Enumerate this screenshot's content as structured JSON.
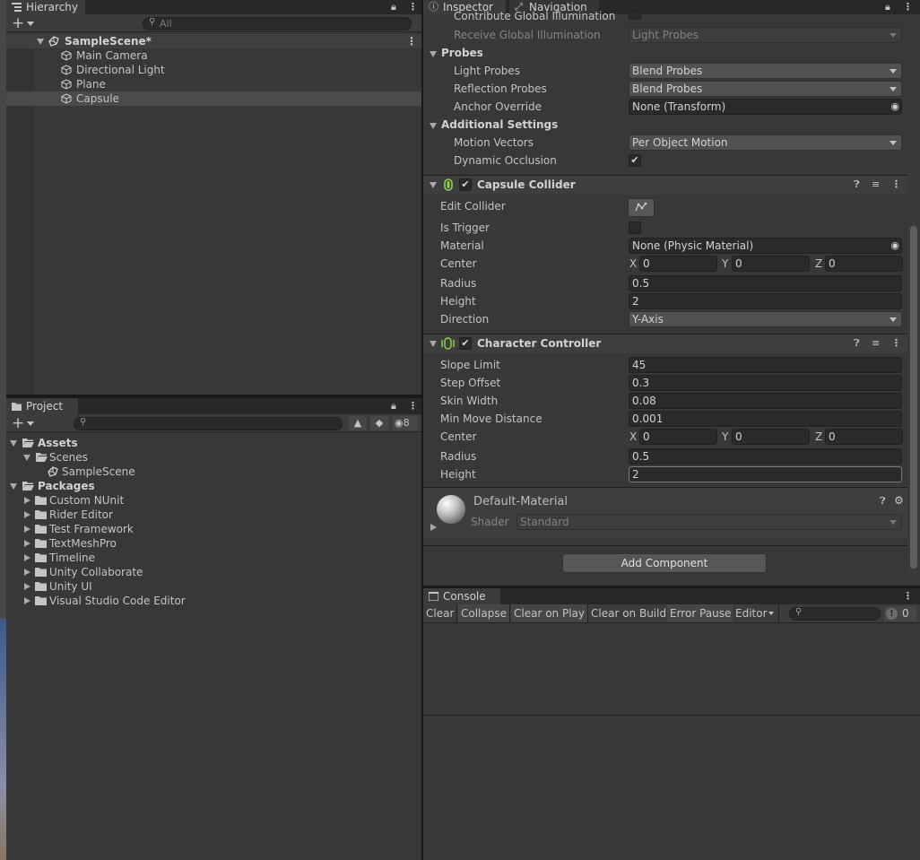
{
  "hierarchy": {
    "tab_label": "Hierarchy",
    "search_placeholder": "All",
    "scene_name": "SampleScene*",
    "objects": [
      "Main Camera",
      "Directional Light",
      "Plane",
      "Capsule"
    ],
    "selected": "Capsule"
  },
  "project": {
    "tab_label": "Project",
    "hidden_count": "8",
    "tree": {
      "assets": "Assets",
      "scenes": "Scenes",
      "sample_scene": "SampleScene",
      "packages": "Packages",
      "package_items": [
        "Custom NUnit",
        "Rider Editor",
        "Test Framework",
        "TextMeshPro",
        "Timeline",
        "Unity Collaborate",
        "Unity UI",
        "Visual Studio Code Editor"
      ]
    }
  },
  "inspector": {
    "tab_inspector": "Inspector",
    "tab_navigation": "Navigation",
    "mesh_renderer": {
      "contribute_gi": "Contribute Global Illumination",
      "receive_gi_label": "Receive Global Illumination",
      "receive_gi_value": "Light Probes",
      "probes_header": "Probes",
      "light_probes_label": "Light Probes",
      "light_probes_value": "Blend Probes",
      "reflection_probes_label": "Reflection Probes",
      "reflection_probes_value": "Blend Probes",
      "anchor_override_label": "Anchor Override",
      "anchor_override_value": "None (Transform)",
      "additional_header": "Additional Settings",
      "motion_vectors_label": "Motion Vectors",
      "motion_vectors_value": "Per Object Motion",
      "dynamic_occlusion_label": "Dynamic Occlusion"
    },
    "capsule_collider": {
      "title": "Capsule Collider",
      "edit_collider": "Edit Collider",
      "is_trigger": "Is Trigger",
      "material_label": "Material",
      "material_value": "None (Physic Material)",
      "center_label": "Center",
      "center": {
        "x": "0",
        "y": "0",
        "z": "0"
      },
      "radius_label": "Radius",
      "radius": "0.5",
      "height_label": "Height",
      "height": "2",
      "direction_label": "Direction",
      "direction": "Y-Axis"
    },
    "character_controller": {
      "title": "Character Controller",
      "slope_limit_label": "Slope Limit",
      "slope_limit": "45",
      "step_offset_label": "Step Offset",
      "step_offset": "0.3",
      "skin_width_label": "Skin Width",
      "skin_width": "0.08",
      "min_move_label": "Min Move Distance",
      "min_move": "0.001",
      "center_label": "Center",
      "center": {
        "x": "0",
        "y": "0",
        "z": "0"
      },
      "radius_label": "Radius",
      "radius": "0.5",
      "height_label": "Height",
      "height": "2"
    },
    "material": {
      "name": "Default-Material",
      "shader_label": "Shader",
      "shader_value": "Standard"
    },
    "add_component": "Add Component",
    "xyz": {
      "x": "X",
      "y": "Y",
      "z": "Z"
    }
  },
  "console": {
    "tab_label": "Console",
    "buttons": {
      "clear": "Clear",
      "collapse": "Collapse",
      "clear_on_play": "Clear on Play",
      "clear_on_build": "Clear on Build",
      "error_pause": "Error Pause",
      "editor": "Editor"
    },
    "error_count": "0"
  }
}
